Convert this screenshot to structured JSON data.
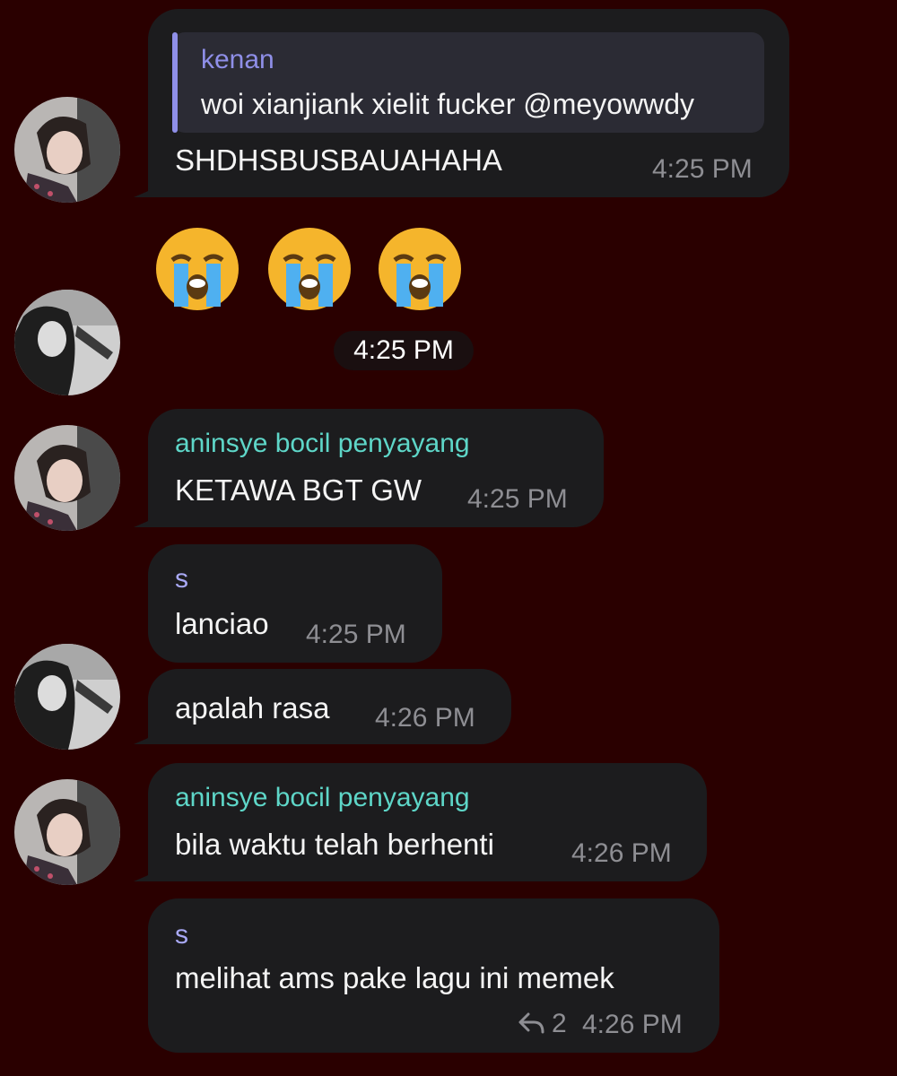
{
  "messages": [
    {
      "quote": {
        "author": "kenan",
        "text": "woi xianjiank xielit fucker @meyowwdy"
      },
      "text": "SHDHSBUSBAUAHAHA",
      "time": "4:25 PM"
    },
    {
      "emojis": [
        "😭",
        "😭",
        "😭"
      ],
      "time": "4:25 PM"
    },
    {
      "sender": "aninsye bocil penyayang",
      "text": "KETAWA BGT GW",
      "time": "4:25 PM"
    },
    {
      "sender": "s",
      "text": "lanciao",
      "time": "4:25 PM"
    },
    {
      "text": "apalah rasa",
      "time": "4:26 PM"
    },
    {
      "sender": "aninsye bocil penyayang",
      "text": "bila waktu telah berhenti",
      "time": "4:26 PM"
    },
    {
      "sender": "s",
      "text": "melihat ams pake lagu ini memek",
      "reply_count": "2",
      "time": "4:26 PM"
    }
  ],
  "colors": {
    "background": "#2a0000",
    "bubble": "#1c1c1e",
    "sender_teal": "#5ed6c8",
    "sender_purple": "#a9a9f5",
    "quote_author": "#8f8fe8",
    "timestamp": "#8e8e93"
  },
  "icons": {
    "reply": "reply-arrow-icon",
    "emoji": "loudly-crying-face"
  }
}
